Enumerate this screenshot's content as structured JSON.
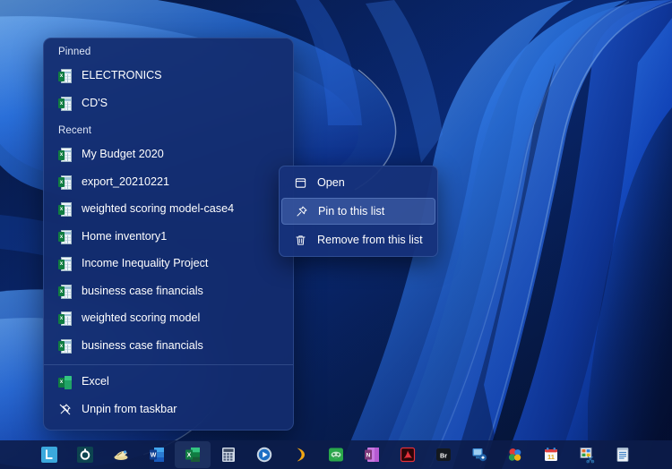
{
  "desktop": {
    "wallpaper_name": "windows-11-bloom-wallpaper",
    "colors": {
      "deep_navy": "#061235",
      "mid_blue": "#1144c4",
      "bright_blue": "#2b7bf5",
      "light_blue": "#5aa8ff",
      "panel_blue": "#132c6e",
      "accent": "#4a8df0"
    }
  },
  "jumplist": {
    "name": "Excel taskbar jump list",
    "sections": [
      {
        "label": "Pinned",
        "items": [
          {
            "label": "ELECTRONICS",
            "icon": "excel-document-icon"
          },
          {
            "label": "CD'S",
            "icon": "excel-document-icon"
          }
        ]
      },
      {
        "label": "Recent",
        "items": [
          {
            "label": "My Budget 2020",
            "icon": "excel-document-icon"
          },
          {
            "label": "export_20210221",
            "icon": "excel-document-icon"
          },
          {
            "label": "weighted scoring model-case4",
            "icon": "excel-document-icon"
          },
          {
            "label": "Home inventory1",
            "icon": "excel-document-icon"
          },
          {
            "label": "Income Inequality Project",
            "icon": "excel-document-icon"
          },
          {
            "label": "business case financials",
            "icon": "excel-document-icon"
          },
          {
            "label": "weighted scoring model",
            "icon": "excel-document-icon"
          },
          {
            "label": "business case financials",
            "icon": "excel-document-icon"
          }
        ]
      }
    ],
    "footer": [
      {
        "label": "Excel",
        "icon": "excel-app-icon"
      },
      {
        "label": "Unpin from taskbar",
        "icon": "unpin-icon"
      }
    ]
  },
  "context_menu": {
    "name": "jump list item context menu",
    "items": [
      {
        "label": "Open",
        "icon": "open-window-icon",
        "selected": false
      },
      {
        "label": "Pin to this list",
        "icon": "pin-icon",
        "selected": true
      },
      {
        "label": "Remove from this list",
        "icon": "trash-icon",
        "selected": false
      }
    ]
  },
  "taskbar": {
    "items": [
      {
        "name": "taskbar-app-lightshot",
        "icon": "letter-L-icon",
        "active": false
      },
      {
        "name": "taskbar-app-tool",
        "icon": "teal-circle-icon",
        "active": false
      },
      {
        "name": "taskbar-app-paint",
        "icon": "paint-icon",
        "active": false
      },
      {
        "name": "taskbar-app-word",
        "icon": "word-icon",
        "active": false
      },
      {
        "name": "taskbar-app-excel",
        "icon": "excel-icon",
        "active": true
      },
      {
        "name": "taskbar-app-calculator",
        "icon": "calculator-icon",
        "active": false
      },
      {
        "name": "taskbar-app-media-player",
        "icon": "media-player-icon",
        "active": false
      },
      {
        "name": "taskbar-app-crescent",
        "icon": "crescent-icon",
        "active": false
      },
      {
        "name": "taskbar-app-green",
        "icon": "green-app-icon",
        "active": false
      },
      {
        "name": "taskbar-app-onenote",
        "icon": "onenote-icon",
        "active": false
      },
      {
        "name": "taskbar-app-acrobat",
        "icon": "acrobat-icon",
        "active": false
      },
      {
        "name": "taskbar-app-bridge",
        "icon": "bridge-icon",
        "active": false
      },
      {
        "name": "taskbar-app-remote",
        "icon": "remote-desktop-icon",
        "active": false
      },
      {
        "name": "taskbar-app-colors",
        "icon": "color-balls-icon",
        "active": false
      },
      {
        "name": "taskbar-app-calendar",
        "icon": "calendar-icon",
        "active": false
      },
      {
        "name": "taskbar-app-snip",
        "icon": "snipping-tool-icon",
        "active": false
      },
      {
        "name": "taskbar-app-notepad",
        "icon": "notepad-icon",
        "active": false
      }
    ]
  }
}
